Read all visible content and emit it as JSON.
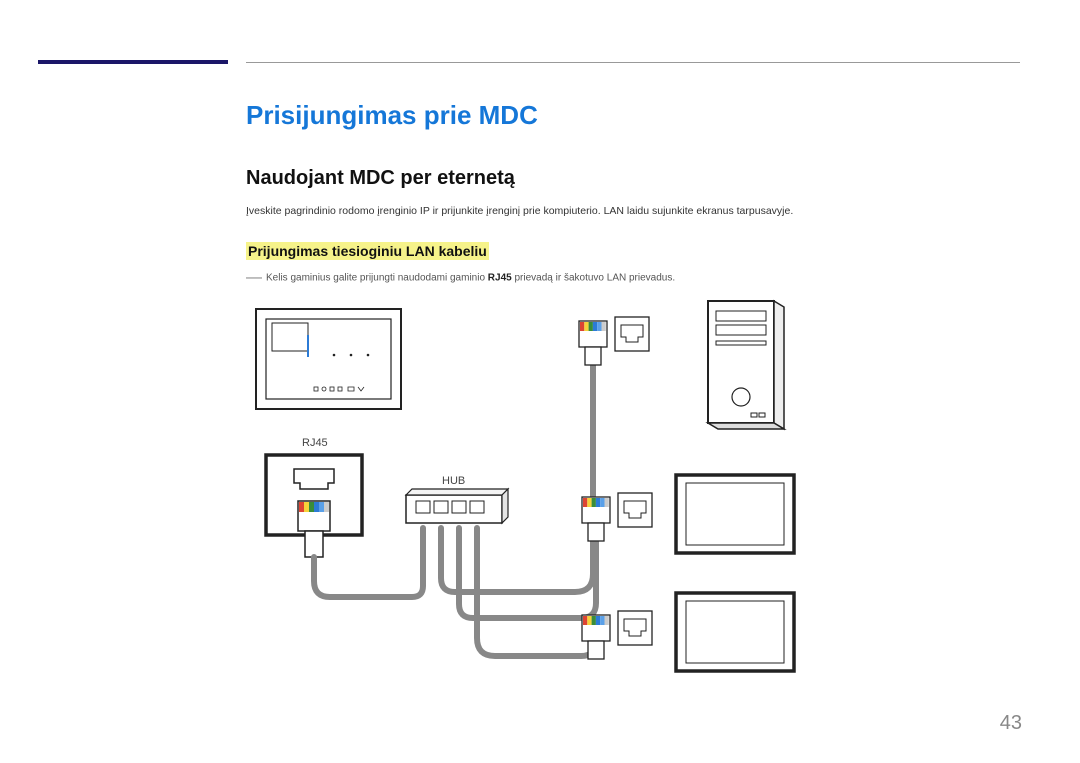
{
  "heading1": "Prisijungimas prie MDC",
  "heading2": "Naudojant MDC per eternetą",
  "paragraph": "Įveskite pagrindinio rodomo įrenginio IP ir prijunkite įrenginį prie kompiuterio. LAN laidu sujunkite ekranus tarpusavyje.",
  "heading3": "Prijungimas tiesioginiu LAN kabeliu",
  "note_pre": "Kelis gaminius galite prijungti naudodami gaminio ",
  "note_bold": "RJ45",
  "note_post": " prievadą ir šakotuvo LAN prievadus.",
  "labels": {
    "rj45": "RJ45",
    "hub": "HUB"
  },
  "page_number": "43"
}
